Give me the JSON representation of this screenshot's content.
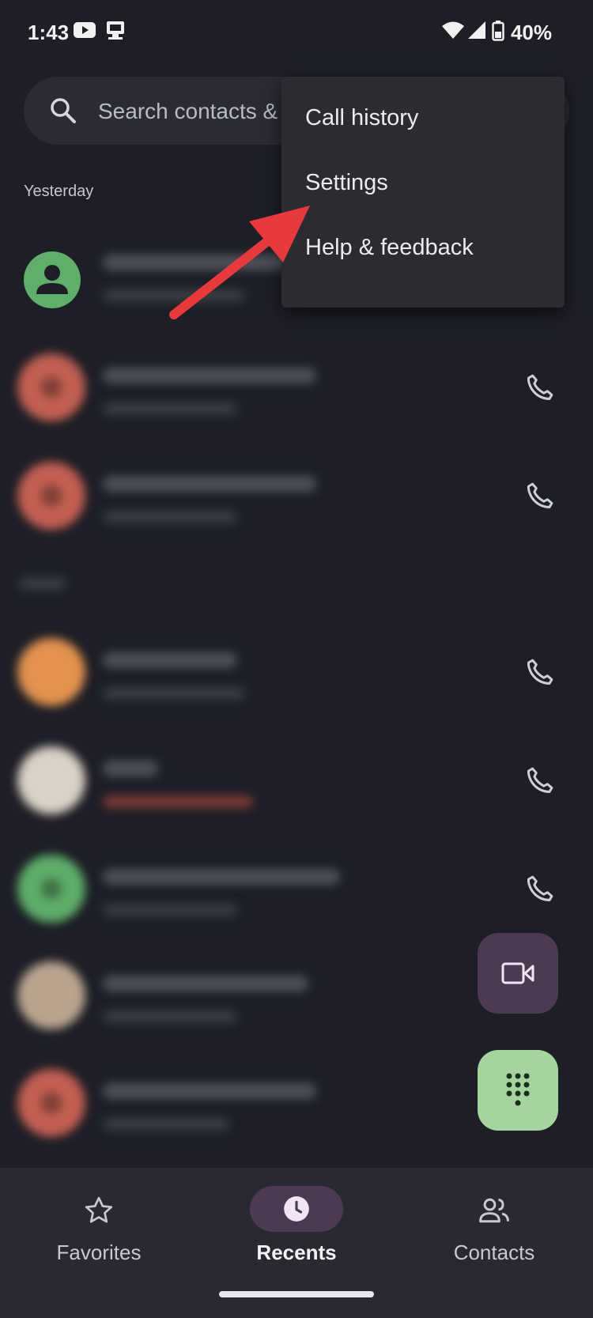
{
  "status_bar": {
    "time": "1:43",
    "battery": "40%"
  },
  "search": {
    "placeholder": "Search contacts &"
  },
  "sections": {
    "yesterday": "Yesterday"
  },
  "menu": {
    "items": [
      "Call history",
      "Settings",
      "Help & feedback"
    ]
  },
  "bottom_nav": {
    "items": [
      "Favorites",
      "Recents",
      "Contacts"
    ],
    "active": "Recents"
  },
  "colors": {
    "background": "#1d1e26",
    "menu_bg": "#2b2c31",
    "accent_purple": "#4b3a52",
    "accent_green": "#a6d49f",
    "annotation_arrow": "#e8393c",
    "avatar_red": "#c25f52",
    "avatar_orange": "#e3924f",
    "avatar_green": "#5fae6a"
  },
  "icons": [
    "youtube-icon",
    "cast-icon",
    "wifi-icon",
    "signal-icon",
    "battery-icon",
    "search-icon",
    "person-icon",
    "phone-icon",
    "video-icon",
    "dialpad-icon",
    "star-icon",
    "clock-icon",
    "people-icon",
    "arrow-annotation"
  ]
}
